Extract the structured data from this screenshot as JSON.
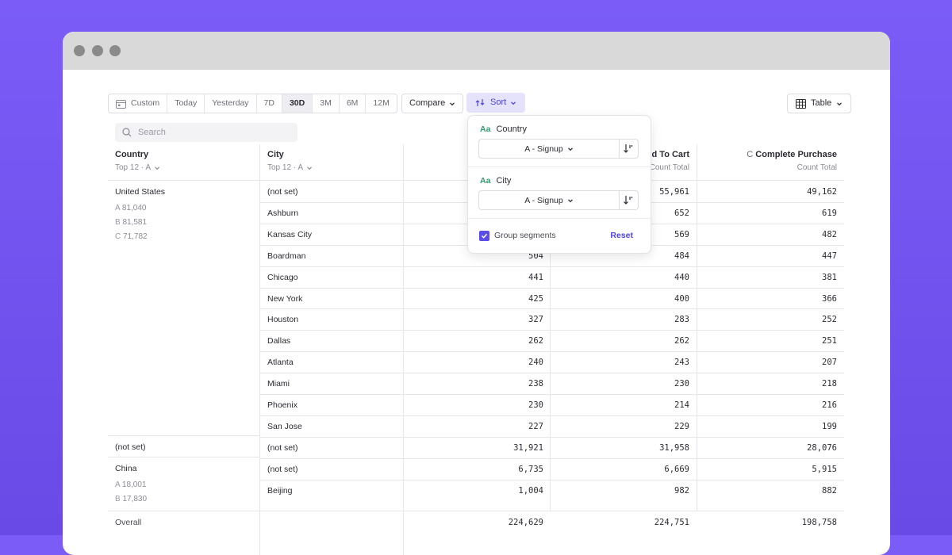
{
  "toolbar": {
    "date_ranges": [
      "Custom",
      "Today",
      "Yesterday",
      "7D",
      "30D",
      "3M",
      "6M",
      "12M"
    ],
    "active_range": "30D",
    "compare_label": "Compare",
    "sort_label": "Sort",
    "view_label": "Table"
  },
  "search": {
    "placeholder": "Search"
  },
  "columns": {
    "country": {
      "title": "Country",
      "sub": "Top 12 · A"
    },
    "city": {
      "title": "City",
      "sub": "Top 12 · A"
    },
    "add_to_cart": {
      "title": "dd To Cart",
      "sub": "Count Total"
    },
    "complete_purchase": {
      "prefix": "C",
      "title": "Complete Purchase",
      "sub": "Count Total"
    }
  },
  "groups": {
    "us": {
      "name": "United States",
      "a": "A",
      "a_val": "81,040",
      "b": "B",
      "b_val": "81,581",
      "c": "C",
      "c_val": "71,782"
    },
    "notset": {
      "name": "(not set)"
    },
    "china": {
      "name": "China",
      "a": "A",
      "a_val": "18,001",
      "b": "B",
      "b_val": "17,830"
    }
  },
  "rows": [
    {
      "city": "(not set)",
      "a": "",
      "b": "55,961",
      "c": "49,162"
    },
    {
      "city": "Ashburn",
      "a": "",
      "b": "652",
      "c": "619"
    },
    {
      "city": "Kansas City",
      "a": "",
      "b": "569",
      "c": "482"
    },
    {
      "city": "Boardman",
      "a": "504",
      "b": "484",
      "c": "447"
    },
    {
      "city": "Chicago",
      "a": "441",
      "b": "440",
      "c": "381"
    },
    {
      "city": "New York",
      "a": "425",
      "b": "400",
      "c": "366"
    },
    {
      "city": "Houston",
      "a": "327",
      "b": "283",
      "c": "252"
    },
    {
      "city": "Dallas",
      "a": "262",
      "b": "262",
      "c": "251"
    },
    {
      "city": "Atlanta",
      "a": "240",
      "b": "243",
      "c": "207"
    },
    {
      "city": "Miami",
      "a": "238",
      "b": "230",
      "c": "218"
    },
    {
      "city": "Phoenix",
      "a": "230",
      "b": "214",
      "c": "216"
    },
    {
      "city": "San Jose",
      "a": "227",
      "b": "229",
      "c": "199"
    },
    {
      "city": "(not set)",
      "a": "31,921",
      "b": "31,958",
      "c": "28,076"
    },
    {
      "city": "(not set)",
      "a": "6,735",
      "b": "6,669",
      "c": "5,915"
    },
    {
      "city": "Beijing",
      "a": "1,004",
      "b": "982",
      "c": "882"
    }
  ],
  "overall": {
    "label": "Overall",
    "a": "224,629",
    "b": "224,751",
    "c": "198,758"
  },
  "sort_popover": {
    "type_badge": "Aa",
    "country_label": "Country",
    "country_sort": "A - Signup",
    "city_label": "City",
    "city_sort": "A - Signup",
    "group_segments_label": "Group segments",
    "group_segments_checked": true,
    "reset_label": "Reset"
  },
  "colors": {
    "accent": "#5a4ee6",
    "background": "#7b5cf7"
  }
}
